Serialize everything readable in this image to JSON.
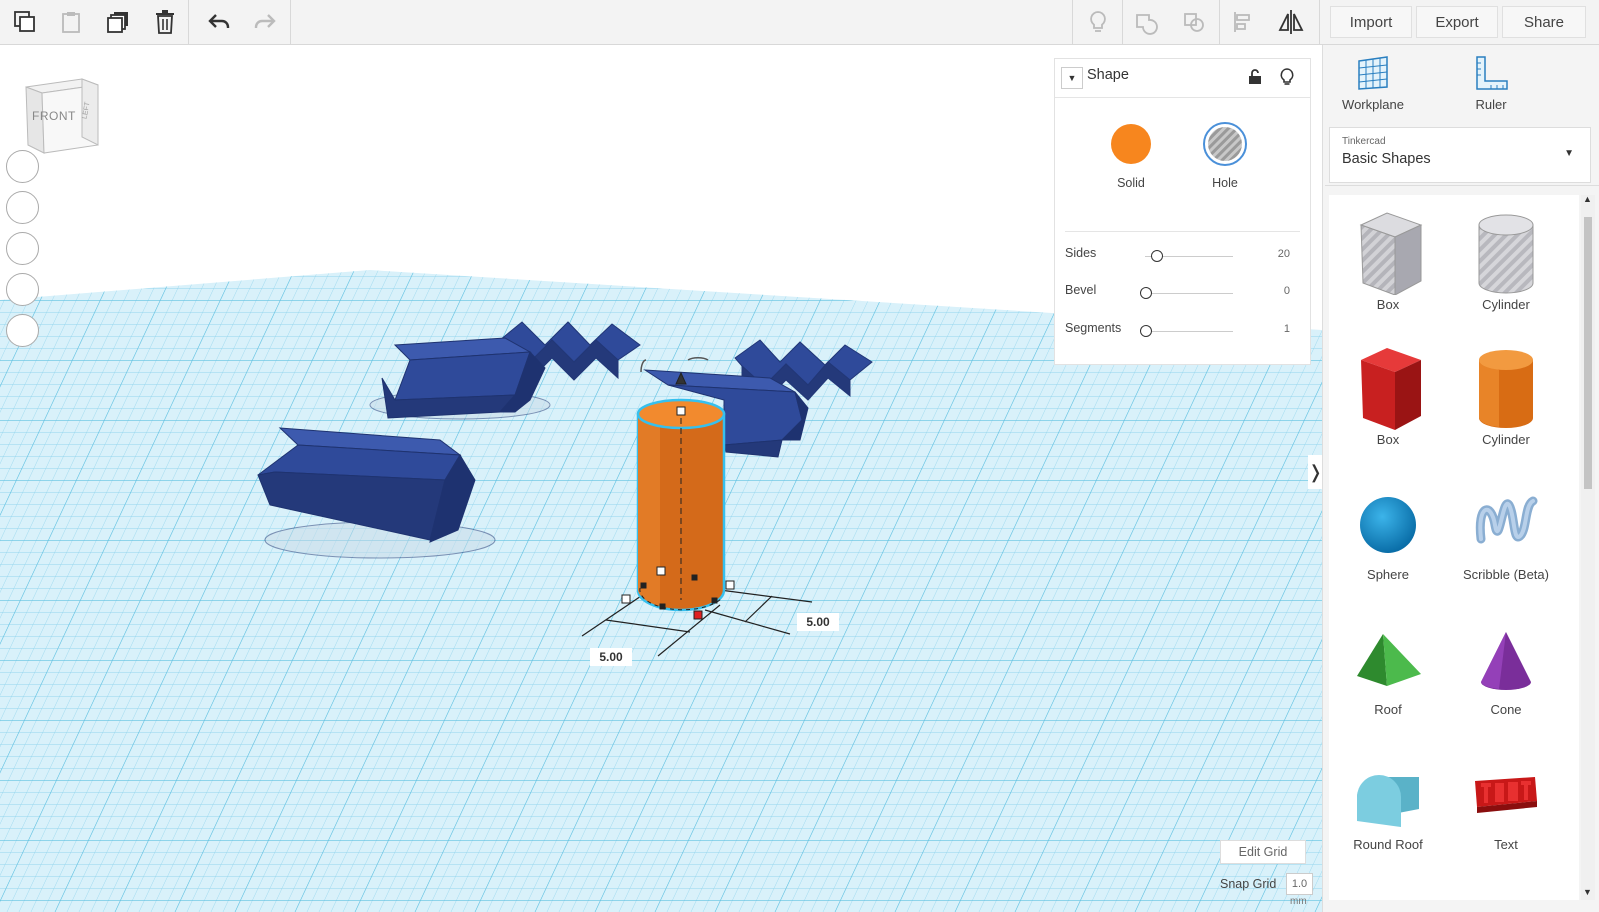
{
  "toolbar": {
    "import_label": "Import",
    "export_label": "Export",
    "share_label": "Share"
  },
  "view_cube": {
    "front_label": "FRONT",
    "side_label": "LEFT"
  },
  "inspector": {
    "title": "Shape",
    "solid_label": "Solid",
    "hole_label": "Hole",
    "properties": [
      {
        "label": "Sides",
        "value": "20",
        "level": 0.12
      },
      {
        "label": "Bevel",
        "value": "0",
        "level": 0.0
      },
      {
        "label": "Segments",
        "value": "1",
        "level": 0.0
      }
    ]
  },
  "sidebar": {
    "workplane_label": "Workplane",
    "ruler_label": "Ruler",
    "library_caption": "Tinkercad",
    "library_value": "Basic Shapes",
    "shapes": [
      {
        "label": "Box"
      },
      {
        "label": "Cylinder"
      },
      {
        "label": "Box"
      },
      {
        "label": "Cylinder"
      },
      {
        "label": "Sphere"
      },
      {
        "label": "Scribble (Beta)"
      },
      {
        "label": "Roof"
      },
      {
        "label": "Cone"
      },
      {
        "label": "Round Roof"
      },
      {
        "label": "Text"
      }
    ]
  },
  "dimensions": {
    "width": "5.00",
    "depth": "5.00"
  },
  "grid": {
    "edit_label": "Edit Grid",
    "snap_label": "Snap Grid",
    "snap_value": "1.0",
    "snap_unit": "mm"
  },
  "colors": {
    "solid": "#f7861e",
    "selected_shape": "#d46a1a",
    "blue_shapes": "#2f4a9a",
    "grid": "#87cde8",
    "selection_outline": "#36c0ee"
  }
}
